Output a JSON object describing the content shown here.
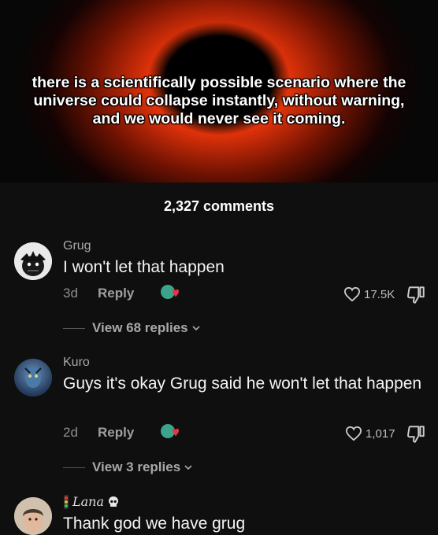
{
  "post": {
    "caption": "there is a scientifically possible scenario where the universe could collapse instantly, without warning, and we would never see it coming."
  },
  "comments_header": {
    "count_label": "2,327 comments"
  },
  "comments": [
    {
      "username": "Grug",
      "text": "I won't let that happen",
      "time": "3d",
      "reply_label": "Reply",
      "likes": "17.5K",
      "view_replies": "View 68 replies"
    },
    {
      "username": "Kuro",
      "text": "Guys it's okay Grug said he won't let that happen",
      "time": "2d",
      "reply_label": "Reply",
      "likes": "1,017",
      "view_replies": "View 3 replies"
    },
    {
      "username": "Lana",
      "text": "Thank god we have grug"
    }
  ],
  "icons": {
    "like": "heart-outline-icon",
    "dislike": "thumbs-down-icon",
    "chevron": "chevron-down-icon",
    "react": "reaction-sticker-icon"
  },
  "colors": {
    "background": "#0f0f0f",
    "glow": "#ff5a1a",
    "muted": "#8e8e8e"
  }
}
